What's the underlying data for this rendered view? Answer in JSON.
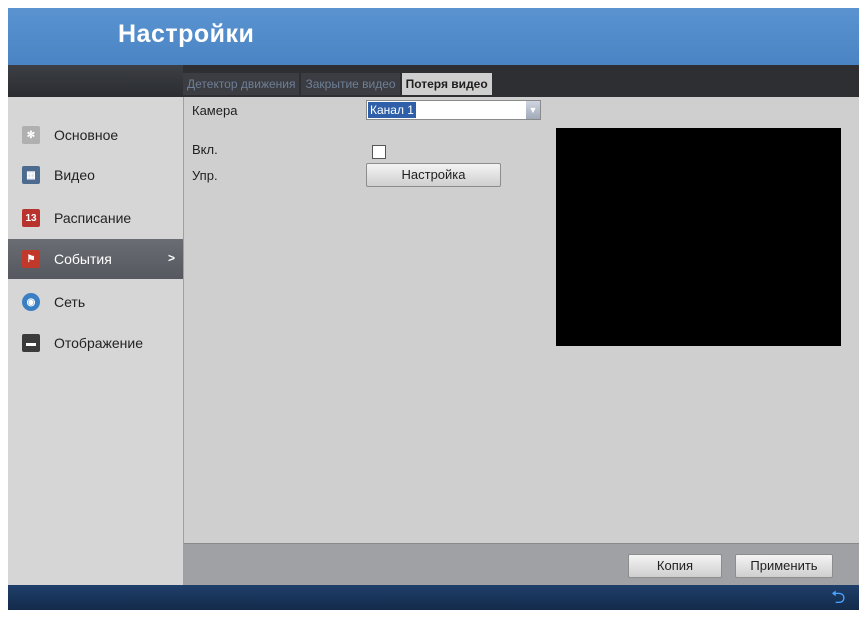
{
  "window": {
    "title": "Настройки"
  },
  "tabs": [
    {
      "label": "Детектор движения",
      "active": false
    },
    {
      "label": "Закрытие видео",
      "active": false
    },
    {
      "label": "Потеря видео",
      "active": true
    }
  ],
  "sidebar": {
    "items": [
      {
        "label": "Основное",
        "icon": "gear-icon",
        "active": false
      },
      {
        "label": "Видео",
        "icon": "video-icon",
        "active": false
      },
      {
        "label": "Расписание",
        "icon": "calendar-icon",
        "active": false
      },
      {
        "label": "События",
        "icon": "events-flag-icon",
        "active": true,
        "arrow": ">"
      },
      {
        "label": "Сеть",
        "icon": "globe-icon",
        "active": false
      },
      {
        "label": "Отображение",
        "icon": "display-icon",
        "active": false
      }
    ]
  },
  "form": {
    "camera_label": "Камера",
    "camera_value": "Канал 1",
    "enable_label": "Вкл.",
    "enable_checked": false,
    "control_label": "Упр.",
    "settings_button": "Настройка"
  },
  "bottom": {
    "copy_button": "Копия",
    "apply_button": "Применить"
  },
  "footer": {
    "back_icon": "return-arrow-icon"
  },
  "colors": {
    "title_bar": "#4a84c4",
    "selection": "#2f5fa8",
    "active_sidebar": "#5a5d63"
  }
}
